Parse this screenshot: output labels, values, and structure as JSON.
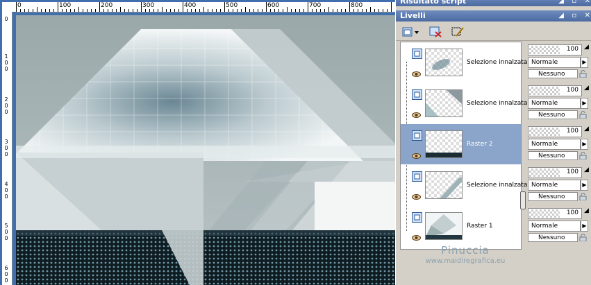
{
  "script_panel": {
    "title": "Risultato script"
  },
  "layers_panel": {
    "title": "Livelli",
    "window_buttons": "◢ ▫ ✕",
    "layers": [
      {
        "name": "Selezione innalzata",
        "opacity": "100",
        "blend": "Normale",
        "mask": "Nessuno",
        "selected": false
      },
      {
        "name": "Selezione innalzata",
        "opacity": "100",
        "blend": "Normale",
        "mask": "Nessuno",
        "selected": false
      },
      {
        "name": "Raster 2",
        "opacity": "100",
        "blend": "Normale",
        "mask": "Nessuno",
        "selected": true
      },
      {
        "name": "Selezione innalzata",
        "opacity": "100",
        "blend": "Normale",
        "mask": "Nessuno",
        "selected": false
      },
      {
        "name": "Raster 1",
        "opacity": "100",
        "blend": "Normale",
        "mask": "Nessuno",
        "selected": false
      }
    ]
  },
  "ruler": {
    "h_labels": [
      "0",
      "100",
      "200",
      "300",
      "400",
      "500",
      "600",
      "700",
      "800"
    ],
    "v_labels": [
      "0",
      "100",
      "200",
      "300",
      "400",
      "500",
      "600"
    ]
  },
  "watermark": {
    "name": "Pinuccia",
    "url": "www.maidiregrafica.eu"
  },
  "colors": {
    "accent": "#4b6aa0",
    "selection": "#8ba4c9",
    "canvas_bg": "#3f6fae"
  }
}
